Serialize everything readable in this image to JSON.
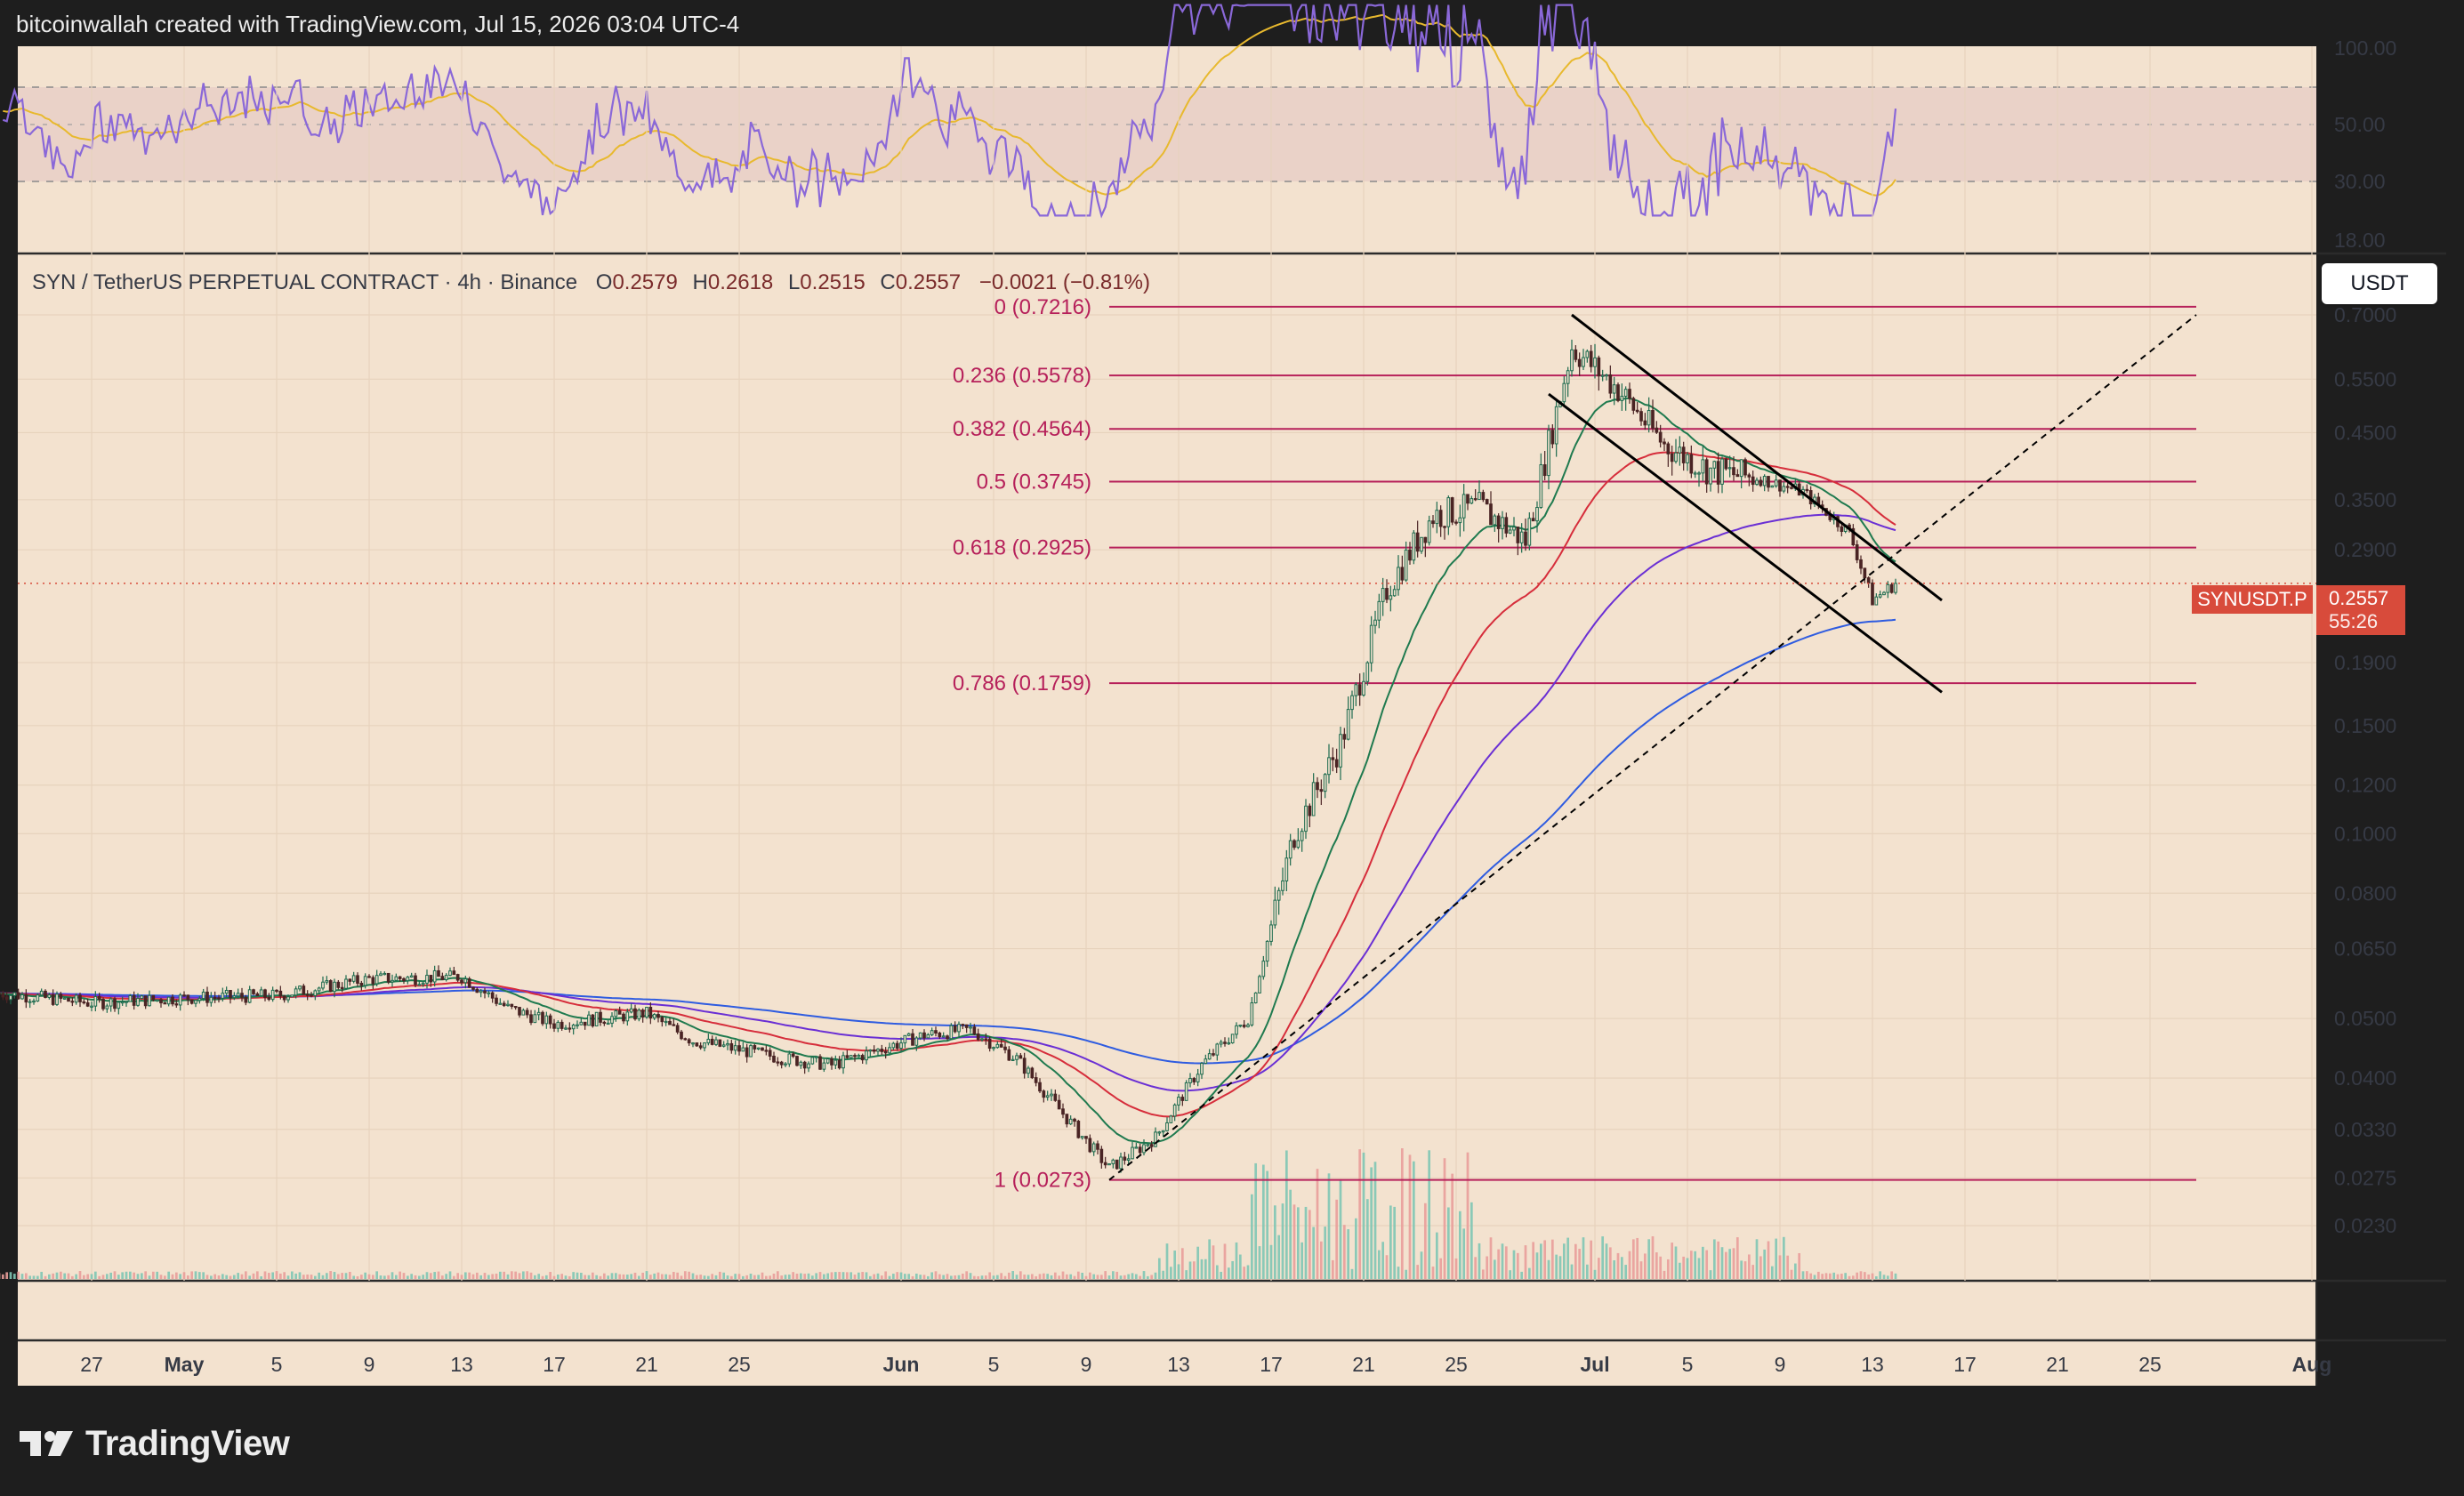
{
  "header": {
    "credit": "bitcoinwallah created with TradingView.com, Jul 15, 2026 03:04 UTC-4"
  },
  "footer": {
    "brand": "TradingView"
  },
  "colors": {
    "background": "#f3e2cf",
    "frame": "#1e1e1e",
    "up_candle": "#1d6b4e",
    "down_candle": "#4a2424",
    "fib": "#b6205a",
    "ema20": "#1f7a4f",
    "ema50": "#d62d3b",
    "ema100": "#6a2fd4",
    "ema200": "#2f5ce0",
    "rsi": "#8a68d8",
    "rsi_ma": "#e8b92e",
    "price_badge": "#d84b3b"
  },
  "rsi_panel": {
    "levels": [
      "100.00",
      "50.00",
      "30.00",
      "18.00"
    ]
  },
  "main_panel": {
    "legend": {
      "symbol": "SYN / TetherUS PERPETUAL CONTRACT · 4h · Binance",
      "open_label": "O",
      "open": "0.2579",
      "high_label": "H",
      "high": "0.2618",
      "low_label": "L",
      "low": "0.2515",
      "close_label": "C",
      "close": "0.2557",
      "change": "−0.0021 (−0.81%)"
    },
    "currency_button": "USDT",
    "price_badge": {
      "ticker": "SYNUSDT.P",
      "price": "0.2557",
      "countdown": "55:26"
    }
  },
  "chart_data": {
    "type": "candlestick",
    "symbol": "SYNUSDT.P",
    "timeframe": "4h",
    "scale": "log",
    "price_axis_ticks": [
      0.7,
      0.55,
      0.45,
      0.35,
      0.29,
      0.19,
      0.15,
      0.12,
      0.1,
      0.08,
      0.065,
      0.05,
      0.04,
      0.033,
      0.0275,
      0.023
    ],
    "price_axis_labels": [
      "0.7000",
      "0.5500",
      "0.4500",
      "0.3500",
      "0.2900",
      "0.1900",
      "0.1500",
      "0.1200",
      "0.1000",
      "0.0800",
      "0.0650",
      "0.0500",
      "0.0400",
      "0.0330",
      "0.0275",
      "0.0230"
    ],
    "x_labels": [
      "27",
      "May",
      "5",
      "9",
      "13",
      "17",
      "21",
      "25",
      "Jun",
      "5",
      "9",
      "13",
      "17",
      "21",
      "25",
      "Jul",
      "5",
      "9",
      "13",
      "17",
      "21",
      "25",
      "Aug"
    ],
    "fibonacci": [
      {
        "label": "0 (0.7216)",
        "price": 0.7216
      },
      {
        "label": "0.236 (0.5578)",
        "price": 0.5578
      },
      {
        "label": "0.382 (0.4564)",
        "price": 0.4564
      },
      {
        "label": "0.5 (0.3745)",
        "price": 0.3745
      },
      {
        "label": "0.618 (0.2925)",
        "price": 0.2925
      },
      {
        "label": "0.786 (0.1759)",
        "price": 0.1759
      },
      {
        "label": "1 (0.0273)",
        "price": 0.0273
      }
    ],
    "last_price": 0.2557,
    "close_path": [
      [
        "Apr 23",
        0.055
      ],
      [
        "Apr 27",
        0.053
      ],
      [
        "May 1",
        0.054
      ],
      [
        "May 5",
        0.0545
      ],
      [
        "May 9",
        0.058
      ],
      [
        "May 13",
        0.0585
      ],
      [
        "May 15",
        0.052
      ],
      [
        "May 17",
        0.049
      ],
      [
        "May 21",
        0.051
      ],
      [
        "May 23",
        0.046
      ],
      [
        "May 27",
        0.043
      ],
      [
        "May 29",
        0.042
      ],
      [
        "Jun 2",
        0.047
      ],
      [
        "Jun 4",
        0.048
      ],
      [
        "Jun 6",
        0.043
      ],
      [
        "Jun 8",
        0.035
      ],
      [
        "Jun 10",
        0.0285
      ],
      [
        "Jun 12",
        0.032
      ],
      [
        "Jun 14",
        0.042
      ],
      [
        "Jun 16",
        0.05
      ],
      [
        "Jun 18",
        0.1
      ],
      [
        "Jun 20",
        0.14
      ],
      [
        "Jun 22",
        0.25
      ],
      [
        "Jun 24",
        0.33
      ],
      [
        "Jun 26",
        0.34
      ],
      [
        "Jun 28",
        0.3
      ],
      [
        "Jun 30",
        0.62
      ],
      [
        "Jul 2",
        0.53
      ],
      [
        "Jul 4",
        0.43
      ],
      [
        "Jul 6",
        0.39
      ],
      [
        "Jul 8",
        0.38
      ],
      [
        "Jul 10",
        0.36
      ],
      [
        "Jul 12",
        0.31
      ],
      [
        "Jul 13",
        0.24
      ],
      [
        "Jul 14",
        0.2557
      ]
    ],
    "channel": {
      "upper": [
        [
          "Jun 30",
          0.7
        ],
        [
          "Jul 16",
          0.24
        ]
      ],
      "lower": [
        [
          "Jun 29",
          0.52
        ],
        [
          "Jul 16",
          0.17
        ]
      ]
    },
    "trendline": [
      [
        "Jun 10",
        0.0273
      ],
      [
        "Jul 27",
        0.7
      ]
    ],
    "rsi": {
      "levels": [
        100,
        50,
        30,
        18
      ],
      "bands": [
        70,
        30
      ]
    }
  }
}
